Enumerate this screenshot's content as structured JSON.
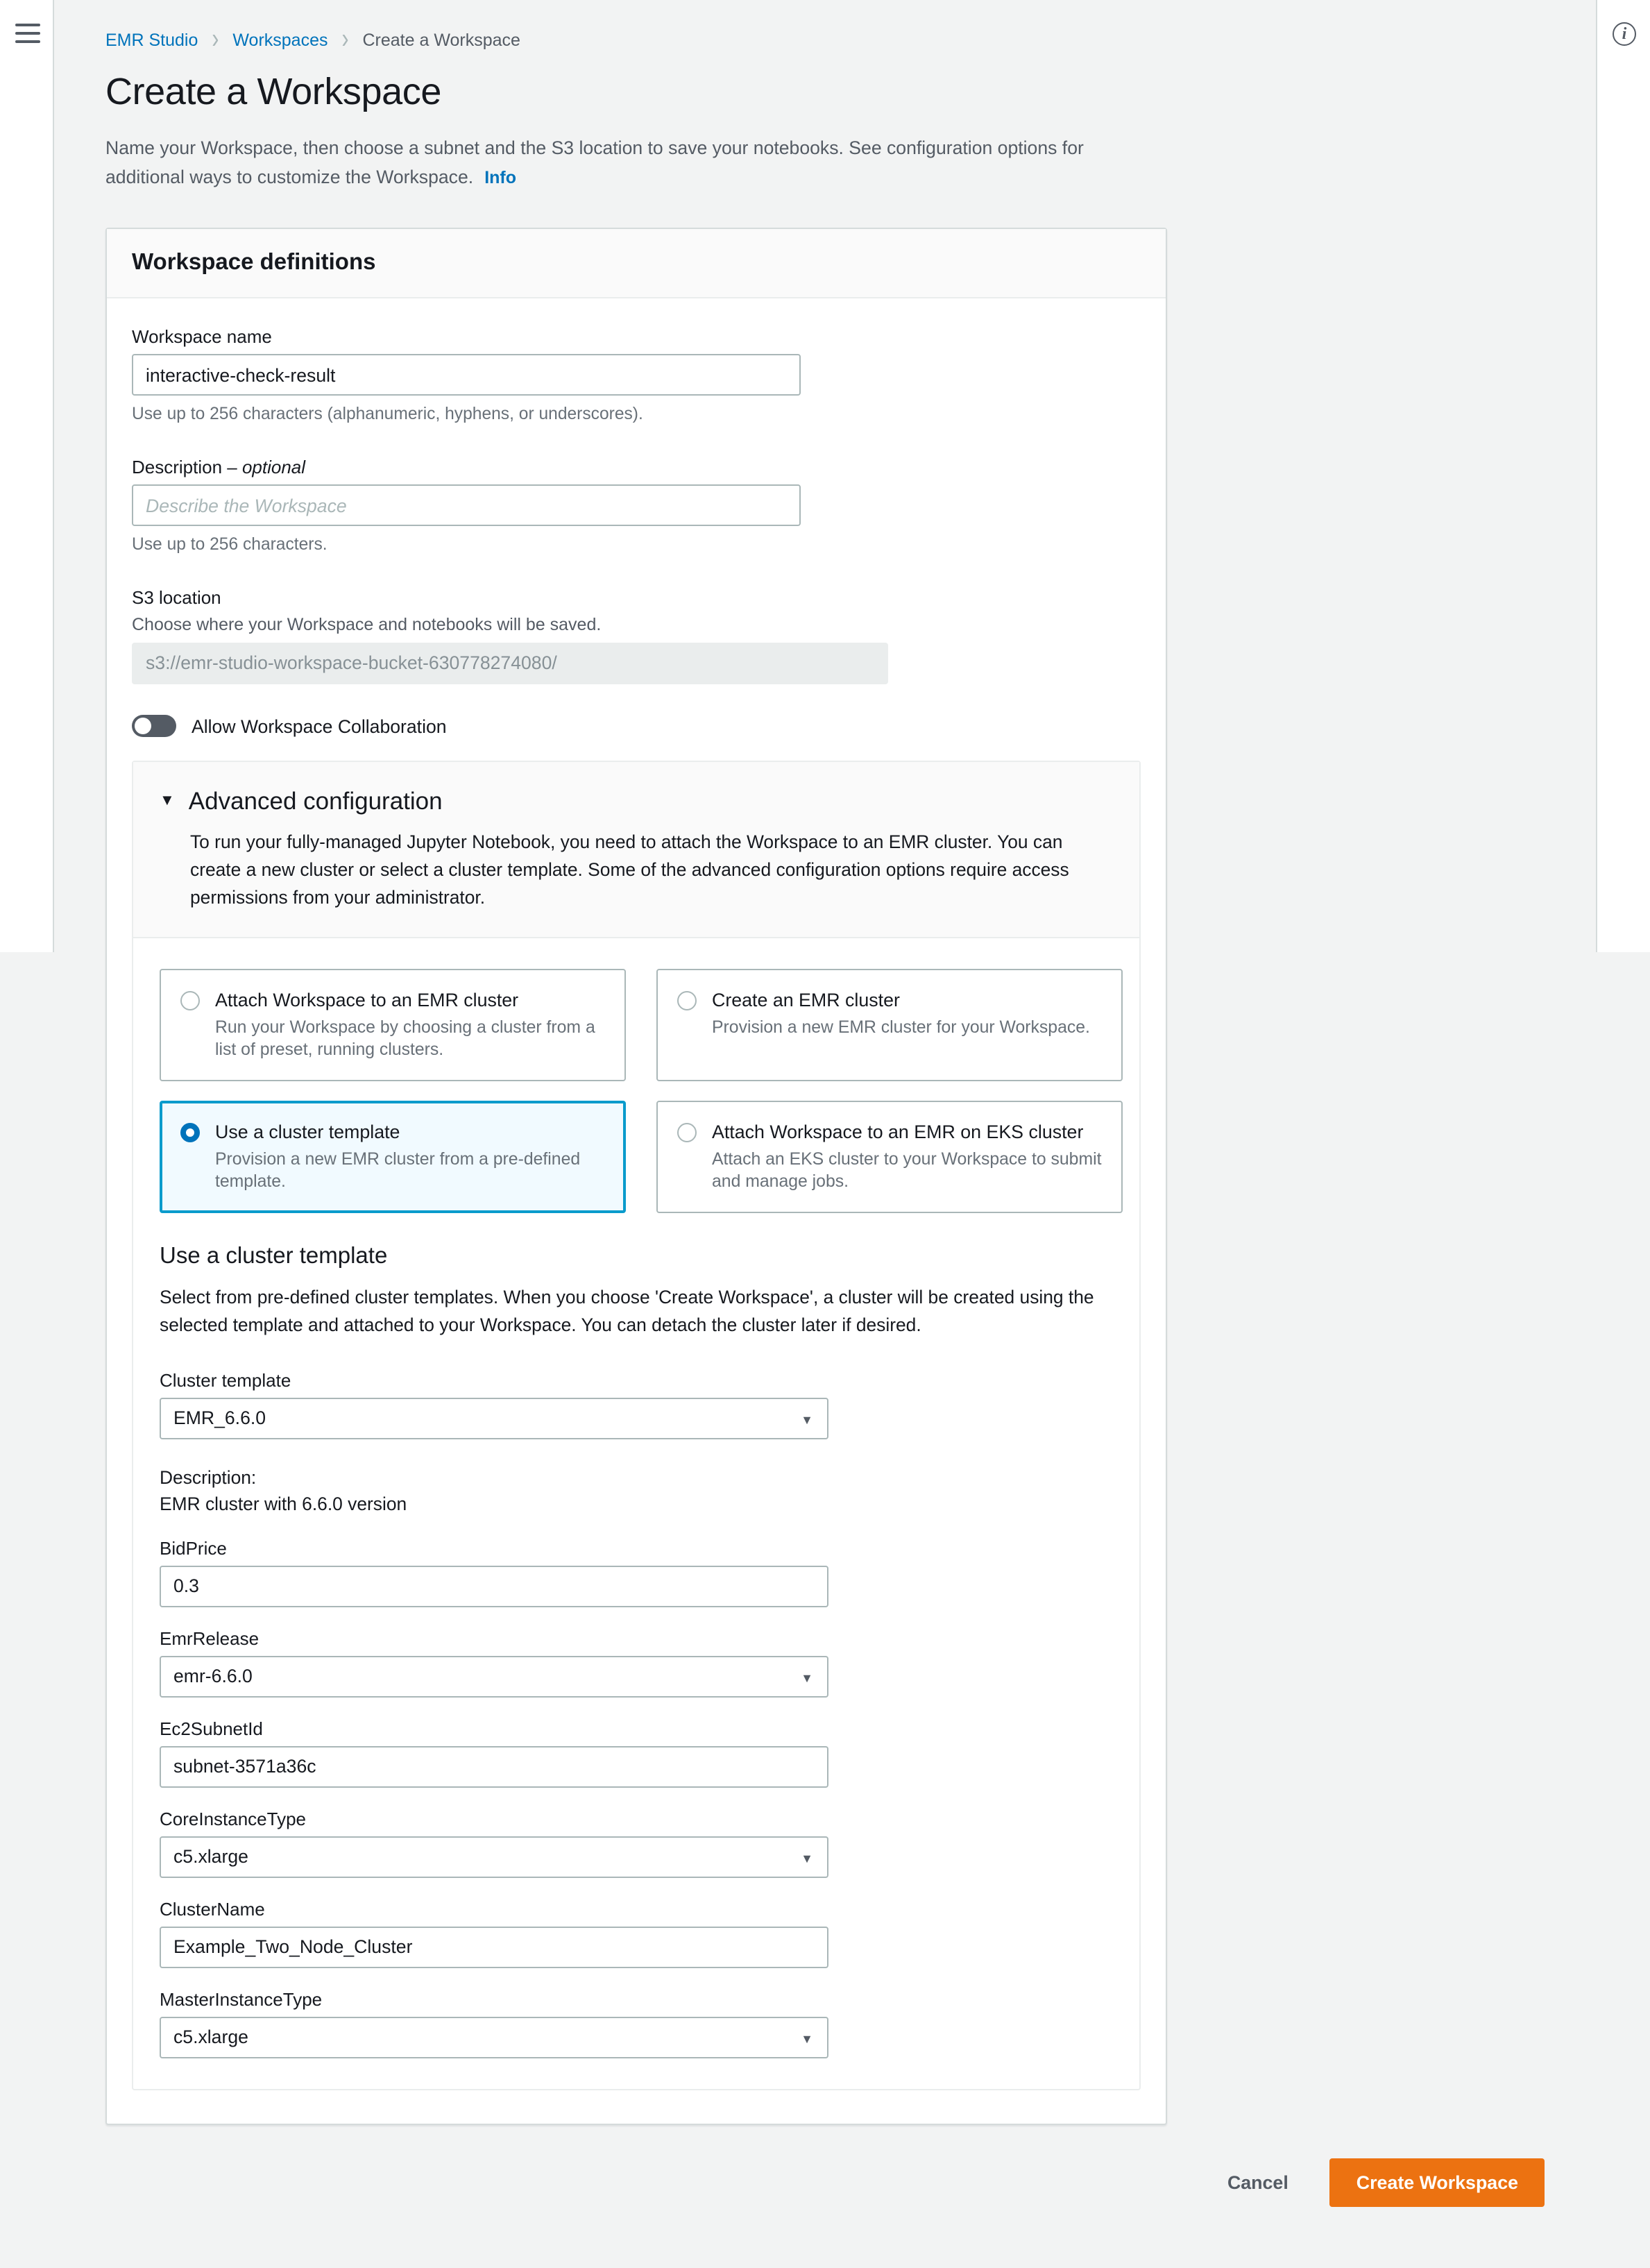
{
  "nav": {
    "menu_icon": "hamburger-icon",
    "info_icon": "info-icon",
    "info_glyph": "i"
  },
  "breadcrumb": {
    "items": [
      {
        "label": "EMR Studio",
        "is_link": true
      },
      {
        "label": "Workspaces",
        "is_link": true
      },
      {
        "label": "Create a Workspace",
        "is_link": false
      }
    ],
    "separator": "›"
  },
  "header": {
    "title": "Create a Workspace",
    "description": "Name your Workspace, then choose a subnet and the S3 location to save your notebooks. See configuration options for additional ways to customize the Workspace.",
    "info_label": "Info"
  },
  "workspace_definitions": {
    "card_title": "Workspace definitions",
    "name": {
      "label": "Workspace name",
      "value": "interactive-check-result",
      "hint": "Use up to 256 characters (alphanumeric, hyphens, or underscores)."
    },
    "description": {
      "label": "Description – ",
      "label_optional": "optional",
      "placeholder": "Describe the Workspace",
      "value": "",
      "hint": "Use up to 256 characters."
    },
    "s3_location": {
      "label": "S3 location",
      "sublabel": "Choose where your Workspace and notebooks will be saved.",
      "value": "s3://emr-studio-workspace-bucket-630778274080/"
    },
    "collaboration": {
      "label": "Allow Workspace Collaboration",
      "enabled": false
    }
  },
  "advanced_configuration": {
    "title": "Advanced configuration",
    "caret": "▼",
    "expanded": true,
    "description": "To run your fully-managed Jupyter Notebook, you need to attach the Workspace to an EMR cluster. You can create a new cluster or select a cluster template. Some of the advanced configuration options require access permissions from your administrator.",
    "options": [
      {
        "title": "Attach Workspace to an EMR cluster",
        "subtitle": "Run your Workspace by choosing a cluster from a list of preset, running clusters.",
        "selected": false
      },
      {
        "title": "Create an EMR cluster",
        "subtitle": "Provision a new EMR cluster for your Workspace.",
        "selected": false
      },
      {
        "title": "Use a cluster template",
        "subtitle": "Provision a new EMR cluster from a pre-defined template.",
        "selected": true
      },
      {
        "title": "Attach Workspace to an EMR on EKS cluster",
        "subtitle": "Attach an EKS cluster to your Workspace to submit and manage jobs.",
        "selected": false
      }
    ]
  },
  "cluster_template_section": {
    "heading": "Use a cluster template",
    "description": "Select from pre-defined cluster templates. When you choose 'Create Workspace', a cluster will be created using the selected template and attached to your Workspace. You can detach the cluster later if desired.",
    "template_select": {
      "label": "Cluster template",
      "value": "EMR_6.6.0",
      "options": [
        "EMR_6.6.0"
      ]
    },
    "template_description_label": "Description:",
    "template_description_value": "EMR cluster with 6.6.0 version",
    "parameters": [
      {
        "label": "BidPrice",
        "value": "0.3",
        "type": "text"
      },
      {
        "label": "EmrRelease",
        "value": "emr-6.6.0",
        "type": "select"
      },
      {
        "label": "Ec2SubnetId",
        "value": "subnet-3571a36c",
        "type": "text"
      },
      {
        "label": "CoreInstanceType",
        "value": "c5.xlarge",
        "type": "select"
      },
      {
        "label": "ClusterName",
        "value": "Example_Two_Node_Cluster",
        "type": "text"
      },
      {
        "label": "MasterInstanceType",
        "value": "c5.xlarge",
        "type": "select"
      }
    ],
    "select_arrow": "▼"
  },
  "footer": {
    "cancel_label": "Cancel",
    "submit_label": "Create Workspace"
  },
  "colors": {
    "link": "#0073bb",
    "primary_button": "#ec7211",
    "selected_border": "#0a9bcc",
    "selected_bg": "#f1faff",
    "page_bg": "#f2f3f3",
    "text": "#16191f",
    "muted_text": "#545b64"
  }
}
